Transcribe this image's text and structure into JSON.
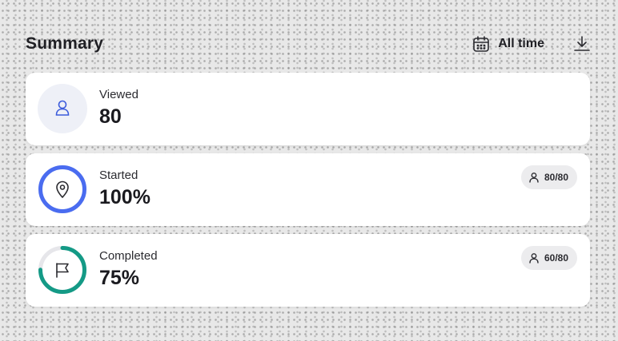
{
  "header": {
    "title": "Summary",
    "range_label": "All time",
    "range_icon": "calendar-icon",
    "download_icon": "download-icon"
  },
  "cards": [
    {
      "label": "Viewed",
      "value": "80",
      "icon": "user-icon"
    },
    {
      "label": "Started",
      "value": "100%",
      "icon": "map-pin-icon",
      "progress": 1.0,
      "color": "#4a6cf0",
      "chip": "80/80",
      "chip_icon": "user-icon"
    },
    {
      "label": "Completed",
      "value": "75%",
      "icon": "flag-icon",
      "progress": 0.75,
      "color": "#149a86",
      "chip": "60/80",
      "chip_icon": "user-icon"
    }
  ],
  "colors": {
    "viewed_icon_bg": "#eef0f7",
    "viewed_icon": "#3b5bdb",
    "ring_track": "#e6e6ea"
  }
}
